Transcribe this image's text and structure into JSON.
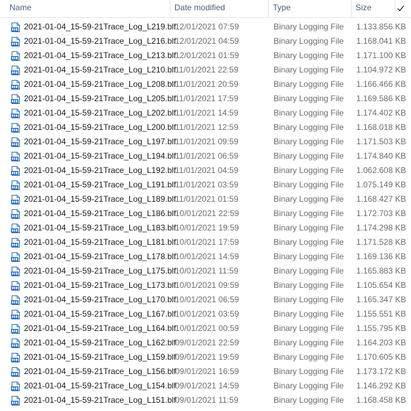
{
  "columns": {
    "name": "Name",
    "date": "Date modified",
    "type": "Type",
    "size": "Size"
  },
  "colors": {
    "header_text": "#4c607a",
    "secondary_text": "#6d6d6d",
    "icon_blue": "#2f6fc7"
  },
  "files": [
    {
      "name": "2021-01-04_15-59-21Trace_Log_L219.blf",
      "date": "12/01/2021 07:59",
      "type": "Binary Logging File",
      "size": "1.133.856 KB"
    },
    {
      "name": "2021-01-04_15-59-21Trace_Log_L216.blf",
      "date": "12/01/2021 04:59",
      "type": "Binary Logging File",
      "size": "1.168.041 KB"
    },
    {
      "name": "2021-01-04_15-59-21Trace_Log_L213.blf",
      "date": "12/01/2021 01:59",
      "type": "Binary Logging File",
      "size": "1.171.100 KB"
    },
    {
      "name": "2021-01-04_15-59-21Trace_Log_L210.blf",
      "date": "11/01/2021 22:59",
      "type": "Binary Logging File",
      "size": "1.104.972 KB"
    },
    {
      "name": "2021-01-04_15-59-21Trace_Log_L208.blf",
      "date": "11/01/2021 20:59",
      "type": "Binary Logging File",
      "size": "1.166.466 KB"
    },
    {
      "name": "2021-01-04_15-59-21Trace_Log_L205.blf",
      "date": "11/01/2021 17:59",
      "type": "Binary Logging File",
      "size": "1.169.586 KB"
    },
    {
      "name": "2021-01-04_15-59-21Trace_Log_L202.blf",
      "date": "11/01/2021 14:59",
      "type": "Binary Logging File",
      "size": "1.174.402 KB"
    },
    {
      "name": "2021-01-04_15-59-21Trace_Log_L200.blf",
      "date": "11/01/2021 12:59",
      "type": "Binary Logging File",
      "size": "1.168.018 KB"
    },
    {
      "name": "2021-01-04_15-59-21Trace_Log_L197.blf",
      "date": "11/01/2021 09:59",
      "type": "Binary Logging File",
      "size": "1.171.503 KB"
    },
    {
      "name": "2021-01-04_15-59-21Trace_Log_L194.blf",
      "date": "11/01/2021 06:59",
      "type": "Binary Logging File",
      "size": "1.174.840 KB"
    },
    {
      "name": "2021-01-04_15-59-21Trace_Log_L192.blf",
      "date": "11/01/2021 04:59",
      "type": "Binary Logging File",
      "size": "1.062.608 KB"
    },
    {
      "name": "2021-01-04_15-59-21Trace_Log_L191.blf",
      "date": "11/01/2021 03:59",
      "type": "Binary Logging File",
      "size": "1.075.149 KB"
    },
    {
      "name": "2021-01-04_15-59-21Trace_Log_L189.blf",
      "date": "11/01/2021 01:59",
      "type": "Binary Logging File",
      "size": "1.168.427 KB"
    },
    {
      "name": "2021-01-04_15-59-21Trace_Log_L186.blf",
      "date": "10/01/2021 22:59",
      "type": "Binary Logging File",
      "size": "1.172.703 KB"
    },
    {
      "name": "2021-01-04_15-59-21Trace_Log_L183.blf",
      "date": "10/01/2021 19:59",
      "type": "Binary Logging File",
      "size": "1.174.298 KB"
    },
    {
      "name": "2021-01-04_15-59-21Trace_Log_L181.blf",
      "date": "10/01/2021 17:59",
      "type": "Binary Logging File",
      "size": "1.171.528 KB"
    },
    {
      "name": "2021-01-04_15-59-21Trace_Log_L178.blf",
      "date": "10/01/2021 14:59",
      "type": "Binary Logging File",
      "size": "1.169.136 KB"
    },
    {
      "name": "2021-01-04_15-59-21Trace_Log_L175.blf",
      "date": "10/01/2021 11:59",
      "type": "Binary Logging File",
      "size": "1.165.883 KB"
    },
    {
      "name": "2021-01-04_15-59-21Trace_Log_L173.blf",
      "date": "10/01/2021 09:59",
      "type": "Binary Logging File",
      "size": "1.105.654 KB"
    },
    {
      "name": "2021-01-04_15-59-21Trace_Log_L170.blf",
      "date": "10/01/2021 06:59",
      "type": "Binary Logging File",
      "size": "1.165.347 KB"
    },
    {
      "name": "2021-01-04_15-59-21Trace_Log_L167.blf",
      "date": "10/01/2021 03:59",
      "type": "Binary Logging File",
      "size": "1.155.551 KB"
    },
    {
      "name": "2021-01-04_15-59-21Trace_Log_L164.blf",
      "date": "10/01/2021 00:59",
      "type": "Binary Logging File",
      "size": "1.155.795 KB"
    },
    {
      "name": "2021-01-04_15-59-21Trace_Log_L162.blf",
      "date": "09/01/2021 22:59",
      "type": "Binary Logging File",
      "size": "1.164.203 KB"
    },
    {
      "name": "2021-01-04_15-59-21Trace_Log_L159.blf",
      "date": "09/01/2021 19:59",
      "type": "Binary Logging File",
      "size": "1.170.605 KB"
    },
    {
      "name": "2021-01-04_15-59-21Trace_Log_L156.blf",
      "date": "09/01/2021 16:59",
      "type": "Binary Logging File",
      "size": "1.173.172 KB"
    },
    {
      "name": "2021-01-04_15-59-21Trace_Log_L154.blf",
      "date": "09/01/2021 14:59",
      "type": "Binary Logging File",
      "size": "1.146.292 KB"
    },
    {
      "name": "2021-01-04_15-59-21Trace_Log_L151.blf",
      "date": "09/01/2021 11:59",
      "type": "Binary Logging File",
      "size": "1.168.458 KB"
    }
  ]
}
